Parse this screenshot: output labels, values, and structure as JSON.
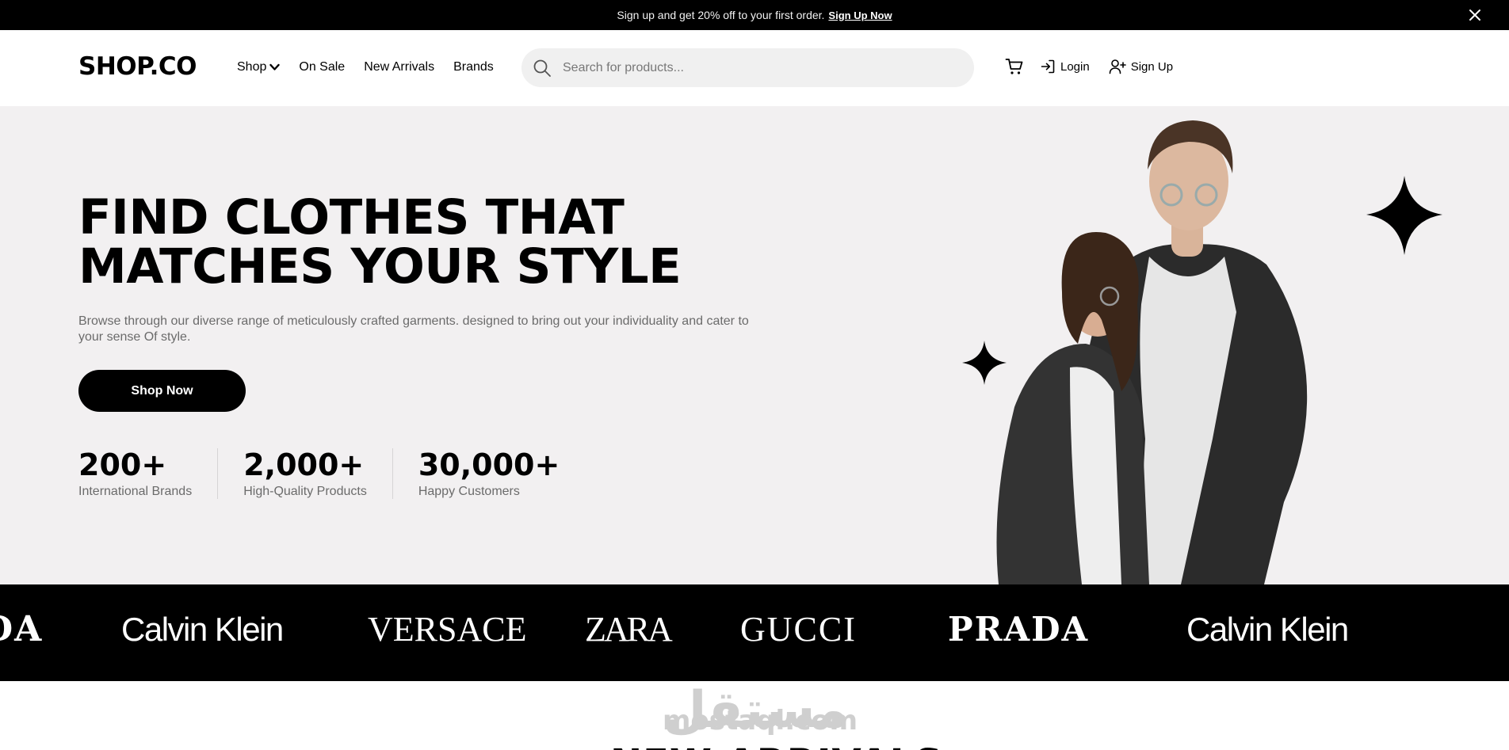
{
  "announcement": {
    "message": "Sign up and get 20% off to your first order.",
    "link_label": "Sign Up Now"
  },
  "header": {
    "logo": "SHOP.CO",
    "nav": [
      {
        "label": "Shop",
        "has_dropdown": true
      },
      {
        "label": "On Sale"
      },
      {
        "label": "New Arrivals"
      },
      {
        "label": "Brands"
      }
    ],
    "search": {
      "placeholder": "Search for products..."
    },
    "actions": {
      "login_label": "Login",
      "signup_label": "Sign Up"
    }
  },
  "hero": {
    "headline_line1": "FIND CLOTHES THAT",
    "headline_line2": "MATCHES YOUR STYLE",
    "description": "Browse through our diverse range of meticulously crafted garments. designed to bring out your individuality and cater to your sense Of style.",
    "cta_label": "Shop Now",
    "stats": [
      {
        "value": "200+",
        "label": "International Brands"
      },
      {
        "value": "2,000+",
        "label": "High-Quality Products"
      },
      {
        "value": "30,000+",
        "label": "Happy Customers"
      }
    ]
  },
  "brands": [
    "DA",
    "Calvin Klein",
    "VERSACE",
    "ZARA",
    "GUCCI",
    "PRADA",
    "Calvin Klein"
  ],
  "watermark": {
    "arabic": "مستقل",
    "latin": "mostaql.com"
  },
  "next_section_title": "NEW ARRIVALS",
  "colors": {
    "primary": "#000000",
    "hero_bg": "#f2f0f1",
    "muted_text": "#6b6b6b",
    "search_bg": "#f0f0f0"
  },
  "icons": [
    "close-icon",
    "chevron-down-icon",
    "search-icon",
    "cart-icon",
    "login-icon",
    "user-plus-icon",
    "sparkle-icon"
  ]
}
